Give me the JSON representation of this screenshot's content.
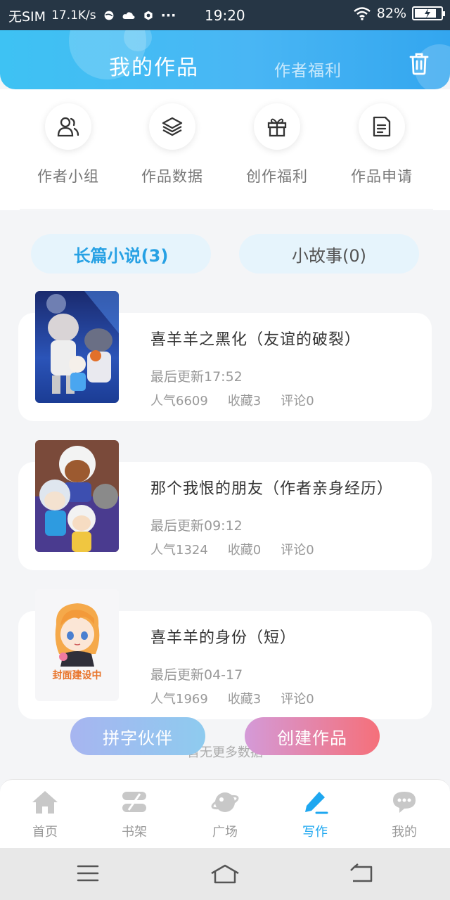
{
  "status_bar": {
    "carrier": "无SIM",
    "speed": "17.1K/s",
    "more": "···",
    "time": "19:20",
    "battery": "82%",
    "battery_level": 0.82
  },
  "header": {
    "title": "我的作品",
    "secondary_tab": "作者福利",
    "trash_icon": "trash-icon"
  },
  "actions": [
    {
      "label": "作者小组",
      "icon": "group-icon"
    },
    {
      "label": "作品数据",
      "icon": "layers-icon"
    },
    {
      "label": "创作福利",
      "icon": "gift-icon"
    },
    {
      "label": "作品申请",
      "icon": "document-icon"
    }
  ],
  "categories": [
    {
      "label": "长篇小说(3)",
      "active": true
    },
    {
      "label": "小故事(0)",
      "active": false
    }
  ],
  "works": [
    {
      "title": "喜羊羊之黑化（友谊的破裂）",
      "updated": "最后更新17:52",
      "popularity": "人气6609",
      "favorites": "收藏3",
      "comments": "评论0"
    },
    {
      "title": "那个我恨的朋友（作者亲身经历）",
      "updated": "最后更新09:12",
      "popularity": "人气1324",
      "favorites": "收藏0",
      "comments": "评论0"
    },
    {
      "title": "喜羊羊的身份（短）",
      "updated": "最后更新04-17",
      "popularity": "人气1969",
      "favorites": "收藏3",
      "comments": "评论0",
      "cover_placeholder": "封面建设中"
    }
  ],
  "buttons": {
    "partner": "拼字伙伴",
    "create": "创建作品"
  },
  "no_more": "暂无更多数据",
  "tabbar": [
    {
      "label": "首页",
      "icon": "home-icon"
    },
    {
      "label": "书架",
      "icon": "bookshelf-icon"
    },
    {
      "label": "广场",
      "icon": "planet-icon"
    },
    {
      "label": "写作",
      "icon": "pen-icon",
      "active": true
    },
    {
      "label": "我的",
      "icon": "chat-icon"
    }
  ],
  "colors": {
    "accent": "#27a1e4",
    "header_gradient_start": "#3ec2f3",
    "header_gradient_end": "#33a6ef",
    "partner_gradient": "#9fb8f0",
    "create_gradient": "#f0747f"
  }
}
